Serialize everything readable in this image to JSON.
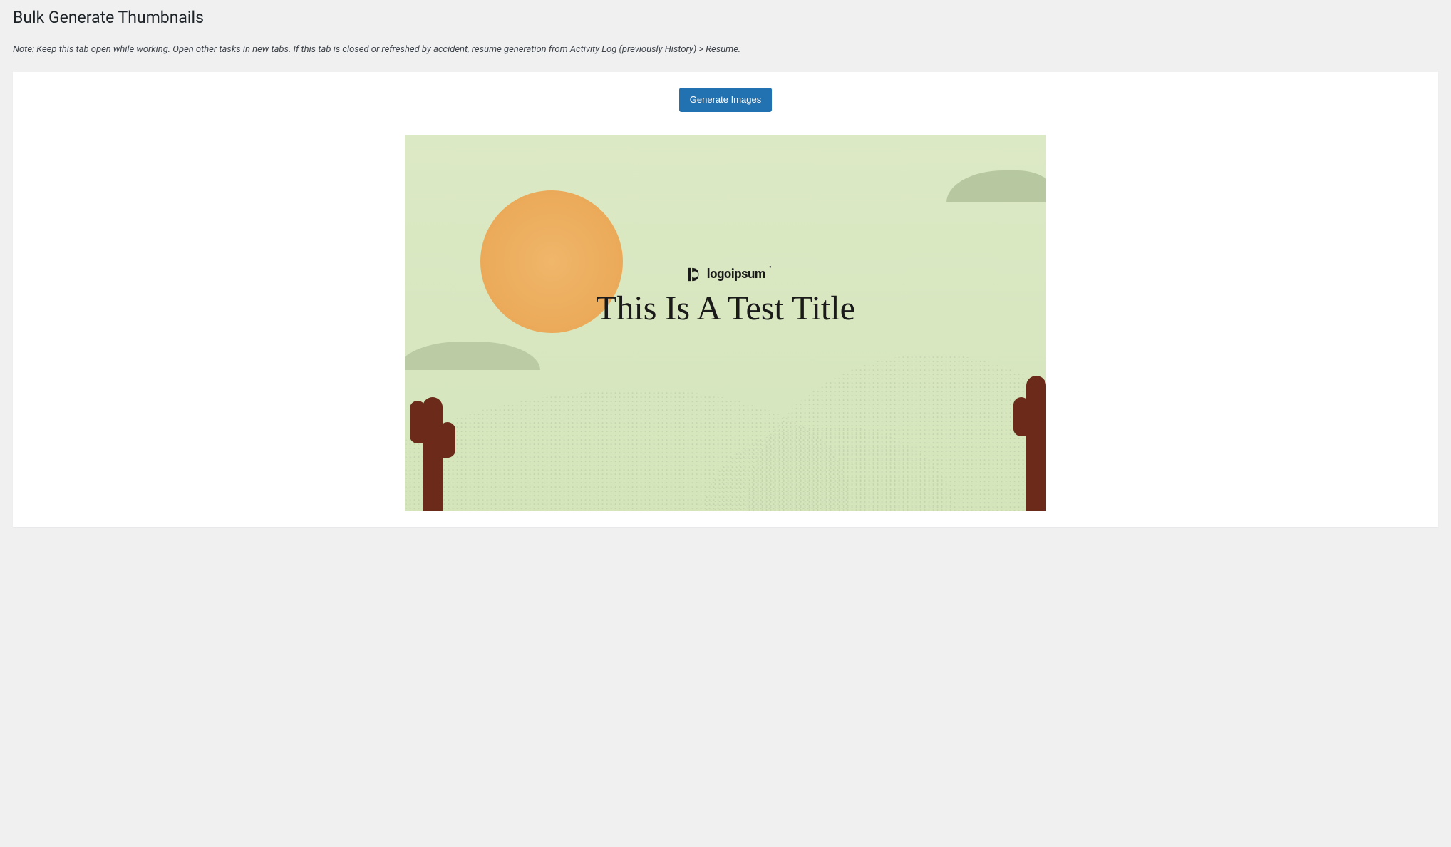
{
  "page": {
    "title": "Bulk Generate Thumbnails",
    "note": "Note: Keep this tab open while working. Open other tasks in new tabs. If this tab is closed or refreshed by accident, resume generation from Activity Log (previously History) > Resume."
  },
  "actions": {
    "generate_label": "Generate Images"
  },
  "preview": {
    "logo_text": "logoipsum",
    "title": "This Is A Test Title"
  },
  "colors": {
    "button_primary": "#2271b1",
    "panel_bg": "#ffffff",
    "page_bg": "#f0f0f1",
    "sky": "#d9e6c2",
    "sun": "#f0b66a",
    "hill": "#1a9b4a",
    "cactus": "#6b2a1a",
    "cloud": "#a8bb92"
  }
}
